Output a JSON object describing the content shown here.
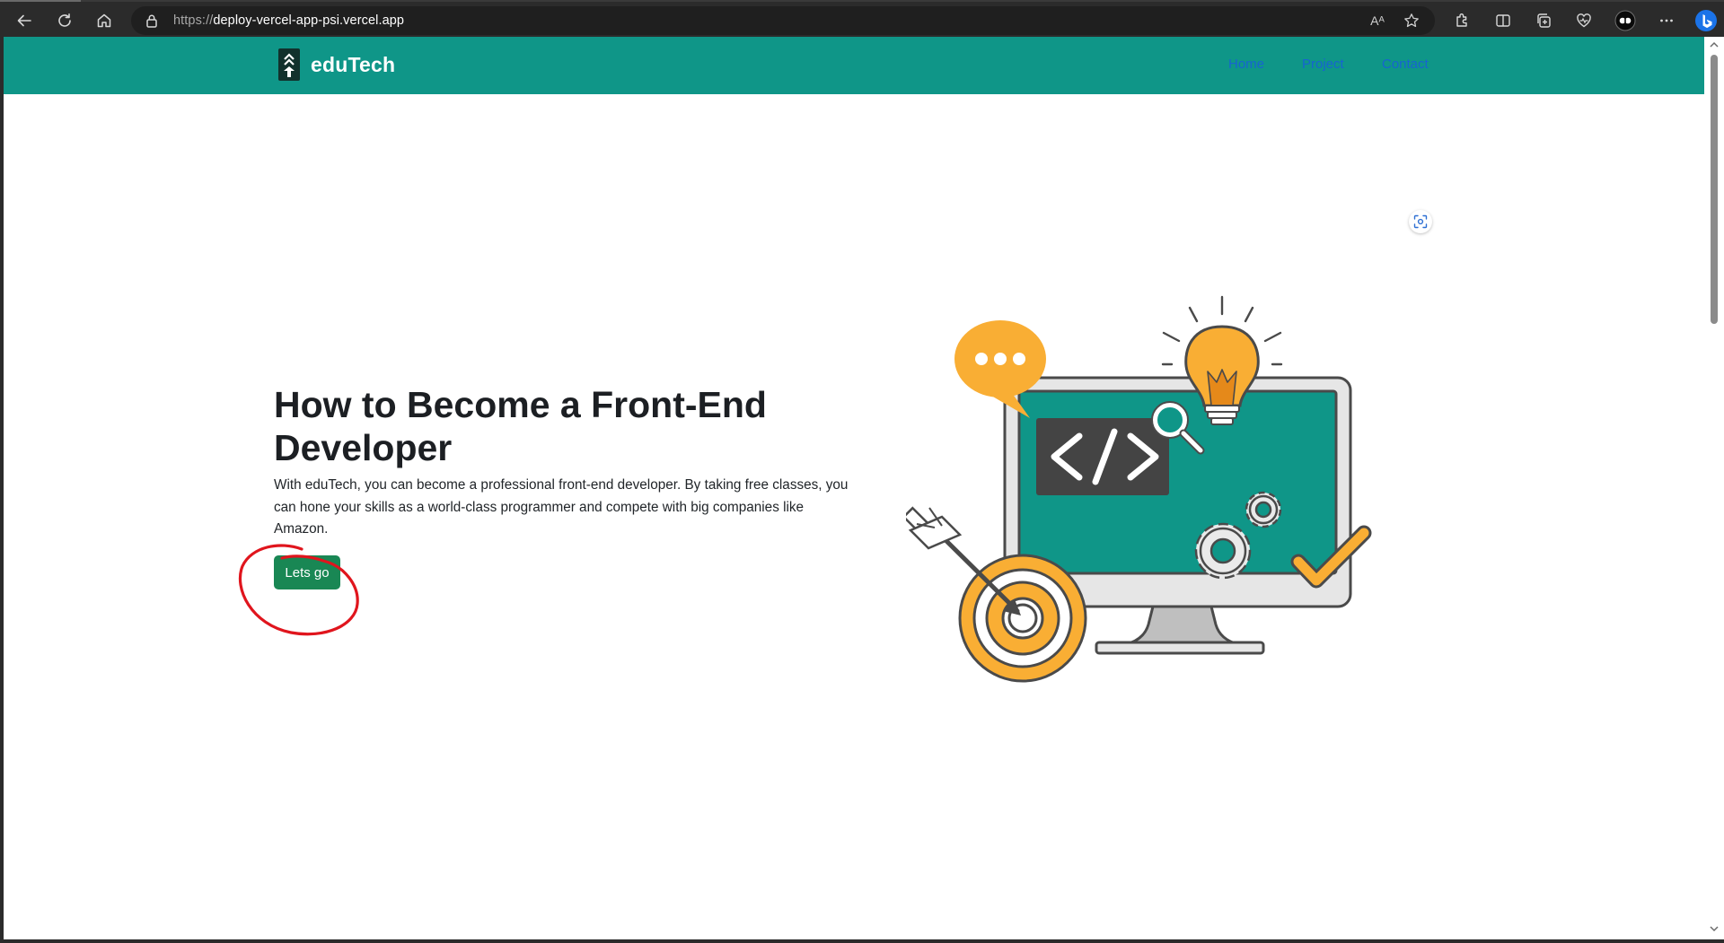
{
  "browser": {
    "url_scheme": "https://",
    "url_host": "deploy-vercel-app-psi.vercel.app",
    "read_aloud_label": "Aᴬ",
    "icons": [
      "back-icon",
      "refresh-icon",
      "home-icon",
      "lock-icon",
      "read-aloud-icon",
      "favorite-star-icon",
      "extensions-icon",
      "split-screen-icon",
      "collections-icon",
      "browser-essentials-icon",
      "profile-icon",
      "more-icon",
      "bing-copilot-icon"
    ]
  },
  "navbar": {
    "brand": "eduTech",
    "links": [
      "Home",
      "Project",
      "Contact"
    ],
    "background": "#0f9688",
    "link_color": "#1764d1"
  },
  "hero": {
    "title": "How to Become a Front-End Developer",
    "text": "With eduTech, you can become a professional front-end developer. By taking free classes, you can hone your skills as a world-class programmer and compete with big companies like Amazon.",
    "button_label": "Lets go",
    "button_color": "#198754"
  },
  "colors": {
    "annotation": "#e0151d",
    "illustration_orange": "#f9ae34",
    "illustration_teal": "#0f9688"
  }
}
